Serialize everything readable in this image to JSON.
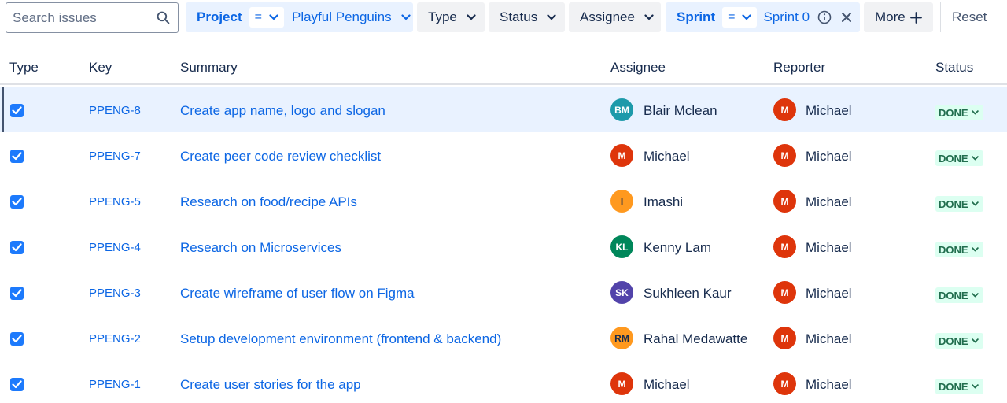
{
  "search": {
    "placeholder": "Search issues",
    "icon": "search-icon"
  },
  "filters": {
    "project": {
      "label": "Project",
      "operator": "=",
      "value": "Playful Penguins"
    },
    "type": {
      "label": "Type"
    },
    "status": {
      "label": "Status"
    },
    "assignee": {
      "label": "Assignee"
    },
    "sprint": {
      "label": "Sprint",
      "operator": "=",
      "value": "Sprint 0"
    },
    "more": {
      "label": "More",
      "icon": "plus-icon"
    },
    "reset": {
      "label": "Reset"
    }
  },
  "table": {
    "headers": {
      "type": "Type",
      "key": "Key",
      "summary": "Summary",
      "assignee": "Assignee",
      "reporter": "Reporter",
      "status": "Status"
    },
    "rows": [
      {
        "key": "PPENG-8",
        "summary": "Create app name, logo and slogan",
        "assignee": {
          "initials": "BM",
          "name": "Blair Mclean",
          "color": "#1d9aaa"
        },
        "reporter": {
          "initials": "M",
          "name": "Michael",
          "color": "#de350b"
        },
        "status": "DONE",
        "selected": true
      },
      {
        "key": "PPENG-7",
        "summary": "Create peer code review checklist",
        "assignee": {
          "initials": "M",
          "name": "Michael",
          "color": "#de350b"
        },
        "reporter": {
          "initials": "M",
          "name": "Michael",
          "color": "#de350b"
        },
        "status": "DONE"
      },
      {
        "key": "PPENG-5",
        "summary": "Research on food/recipe APIs",
        "assignee": {
          "initials": "I",
          "name": "Imashi",
          "color": "#ff991f"
        },
        "reporter": {
          "initials": "M",
          "name": "Michael",
          "color": "#de350b"
        },
        "status": "DONE"
      },
      {
        "key": "PPENG-4",
        "summary": "Research on Microservices",
        "assignee": {
          "initials": "KL",
          "name": "Kenny Lam",
          "color": "#00875a"
        },
        "reporter": {
          "initials": "M",
          "name": "Michael",
          "color": "#de350b"
        },
        "status": "DONE"
      },
      {
        "key": "PPENG-3",
        "summary": "Create wireframe of user flow on Figma",
        "assignee": {
          "initials": "SK",
          "name": "Sukhleen Kaur",
          "color": "#5243aa"
        },
        "reporter": {
          "initials": "M",
          "name": "Michael",
          "color": "#de350b"
        },
        "status": "DONE"
      },
      {
        "key": "PPENG-2",
        "summary": "Setup development environment (frontend & backend)",
        "assignee": {
          "initials": "RM",
          "name": "Rahal Medawatte",
          "color": "#ff991f"
        },
        "reporter": {
          "initials": "M",
          "name": "Michael",
          "color": "#de350b"
        },
        "status": "DONE"
      },
      {
        "key": "PPENG-1",
        "summary": "Create user stories for the app",
        "assignee": {
          "initials": "M",
          "name": "Michael",
          "color": "#de350b"
        },
        "reporter": {
          "initials": "M",
          "name": "Michael",
          "color": "#de350b"
        },
        "status": "DONE"
      }
    ]
  },
  "colors": {
    "link": "#0c66e4",
    "done_bg": "#dcfff1",
    "done_text": "#216e4e",
    "checkbox": "#1d7afc",
    "selected_row": "#e9f2ff"
  }
}
